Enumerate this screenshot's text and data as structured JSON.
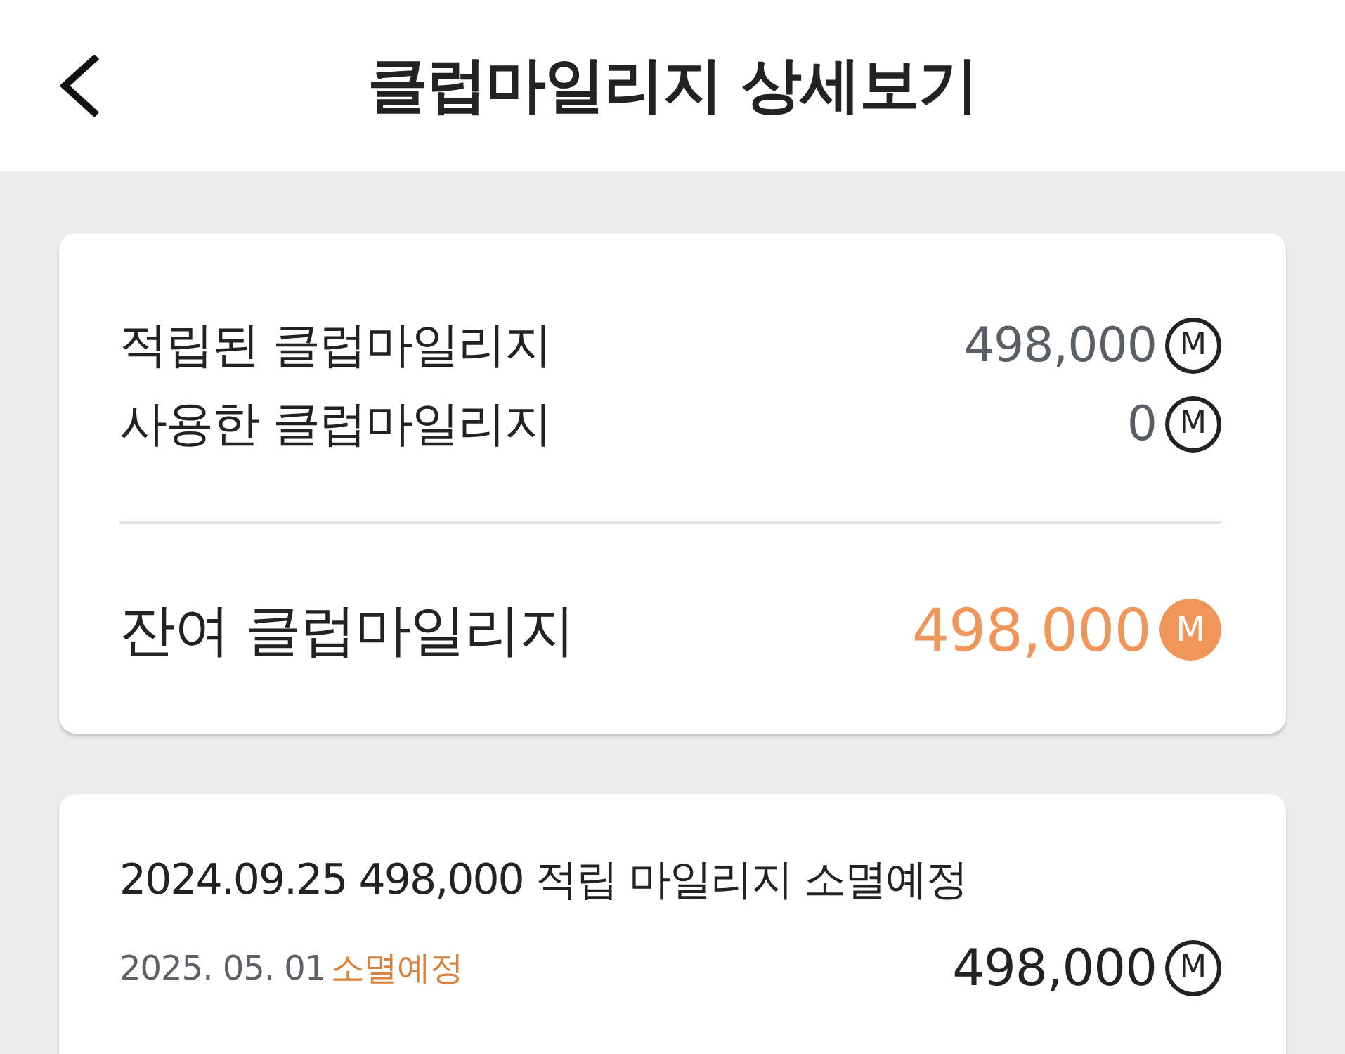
{
  "header": {
    "title": "클럽마일리지 상세보기"
  },
  "summary": {
    "rows": [
      {
        "label": "적립된 클럽마일리지",
        "value": "498,000",
        "unit": "M"
      },
      {
        "label": "사용한 클럽마일리지",
        "value": "0",
        "unit": "M"
      }
    ],
    "total": {
      "label": "잔여 클럽마일리지",
      "value": "498,000",
      "unit": "M"
    }
  },
  "history": [
    {
      "title": "2024.09.25 498,000 적립 마일리지 소멸예정",
      "date": "2025. 05. 01",
      "status": "소멸예정",
      "amount": "498,000",
      "unit": "M"
    }
  ]
}
